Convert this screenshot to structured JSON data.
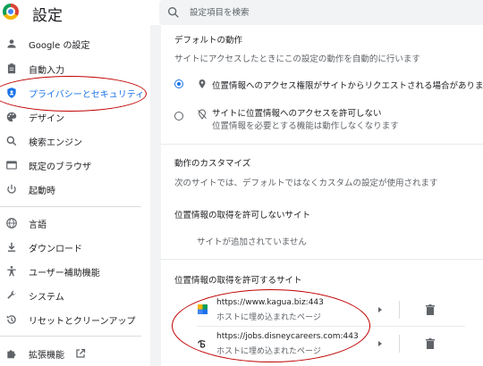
{
  "header": {
    "title": "設定",
    "search_placeholder": "設定項目を検索"
  },
  "sidebar": {
    "items": [
      {
        "label": "Google の設定",
        "icon": "person-icon"
      },
      {
        "label": "自動入力",
        "icon": "clipboard-icon"
      },
      {
        "label": "プライバシーとセキュリティ",
        "icon": "shield-icon",
        "active": true
      },
      {
        "label": "デザイン",
        "icon": "palette-icon"
      },
      {
        "label": "検索エンジン",
        "icon": "search-icon"
      },
      {
        "label": "既定のブラウザ",
        "icon": "browser-icon"
      },
      {
        "label": "起動時",
        "icon": "power-icon"
      },
      {
        "label": "言語",
        "icon": "globe-icon"
      },
      {
        "label": "ダウンロード",
        "icon": "download-icon"
      },
      {
        "label": "ユーザー補助機能",
        "icon": "accessibility-icon"
      },
      {
        "label": "システム",
        "icon": "wrench-icon"
      },
      {
        "label": "リセットとクリーンアップ",
        "icon": "restore-icon"
      },
      {
        "label": "拡張機能",
        "icon": "puzzle-icon"
      }
    ]
  },
  "main": {
    "default_behavior": {
      "title": "デフォルトの動作",
      "description": "サイトにアクセスしたときにこの設定の動作を自動的に行います",
      "options": [
        {
          "label": "位置情報へのアクセス権限がサイトからリクエストされる場合があります",
          "sub": "",
          "selected": true
        },
        {
          "label": "サイトに位置情報へのアクセスを許可しない",
          "sub": "位置情報を必要とする機能は動作しなくなります",
          "selected": false
        }
      ]
    },
    "customize": {
      "title": "動作のカスタマイズ",
      "description": "次のサイトでは、デフォルトではなくカスタムの設定が使用されます"
    },
    "blocked": {
      "title": "位置情報の取得を許可しないサイト",
      "empty": "サイトが追加されていません"
    },
    "allowed": {
      "title": "位置情報の取得を許可するサイト",
      "sites": [
        {
          "url": "https://www.kagua.biz:443",
          "sub": "ホストに埋め込まれたページ"
        },
        {
          "url": "https://jobs.disneycareers.com:443",
          "sub": "ホストに埋め込まれたページ"
        }
      ]
    }
  },
  "colors": {
    "accent": "#1a73e8",
    "annotation": "#c00000"
  }
}
